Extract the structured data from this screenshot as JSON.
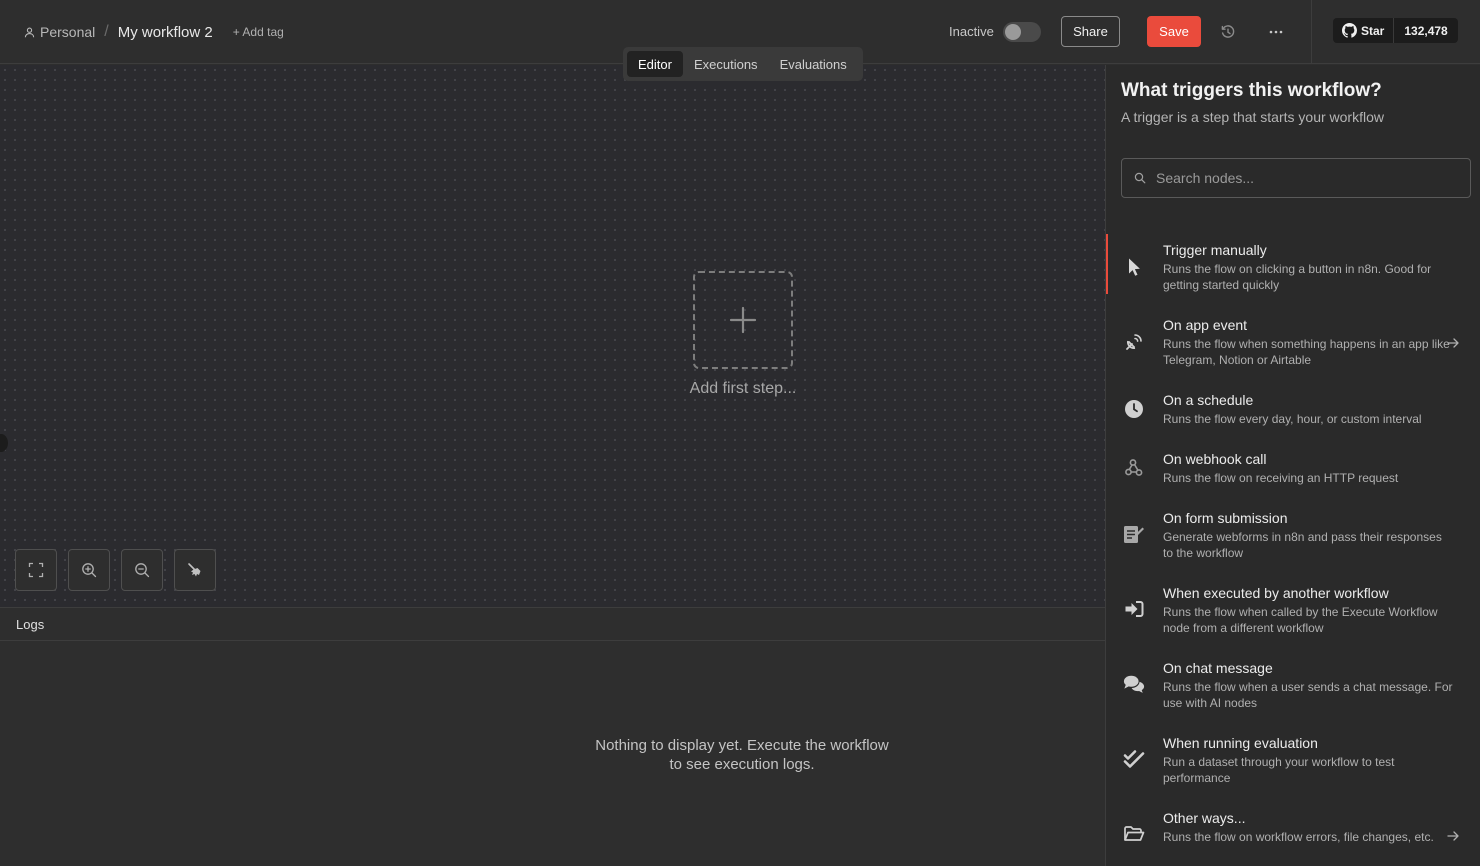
{
  "header": {
    "breadcrumb_project": "Personal",
    "breadcrumb_separator": "/",
    "workflow_name": "My workflow 2",
    "add_tag": "+ Add tag",
    "status_label": "Inactive",
    "active": false,
    "share_label": "Share",
    "save_label": "Save",
    "github_star_label": "Star",
    "github_star_count": "132,478"
  },
  "tabs": [
    {
      "label": "Editor",
      "active": true
    },
    {
      "label": "Executions",
      "active": false
    },
    {
      "label": "Evaluations",
      "active": false
    }
  ],
  "canvas": {
    "add_first_step": "Add first step..."
  },
  "logs": {
    "title": "Logs",
    "empty_message": "Nothing to display yet. Execute the workflow to see execution logs."
  },
  "panel": {
    "title": "What triggers this workflow?",
    "subtitle": "A trigger is a step that starts your workflow",
    "search_placeholder": "Search nodes...",
    "items": [
      {
        "title": "Trigger manually",
        "description": "Runs the flow on clicking a button in n8n. Good for getting started quickly",
        "icon": "cursor-icon",
        "has_arrow": false,
        "active": true
      },
      {
        "title": "On app event",
        "description": "Runs the flow when something happens in an app like Telegram, Notion or Airtable",
        "icon": "satellite-dish-icon",
        "has_arrow": true,
        "active": false
      },
      {
        "title": "On a schedule",
        "description": "Runs the flow every day, hour, or custom interval",
        "icon": "clock-icon",
        "has_arrow": false,
        "active": false
      },
      {
        "title": "On webhook call",
        "description": "Runs the flow on receiving an HTTP request",
        "icon": "webhook-icon",
        "has_arrow": false,
        "active": false
      },
      {
        "title": "On form submission",
        "description": "Generate webforms in n8n and pass their responses to the workflow",
        "icon": "form-icon",
        "has_arrow": false,
        "active": false
      },
      {
        "title": "When executed by another workflow",
        "description": "Runs the flow when called by the Execute Workflow node from a different workflow",
        "icon": "sign-in-icon",
        "has_arrow": false,
        "active": false
      },
      {
        "title": "On chat message",
        "description": "Runs the flow when a user sends a chat message. For use with AI nodes",
        "icon": "chat-icon",
        "has_arrow": false,
        "active": false
      },
      {
        "title": "When running evaluation",
        "description": "Run a dataset through your workflow to test performance",
        "icon": "check-double-icon",
        "has_arrow": false,
        "active": false
      },
      {
        "title": "Other ways...",
        "description": "Runs the flow on workflow errors, file changes, etc.",
        "icon": "folder-open-icon",
        "has_arrow": true,
        "active": false
      }
    ]
  },
  "colors": {
    "accent": "#ea4b3c",
    "background": "#2e2e2e",
    "canvas": "#2b2b2f",
    "panel": "#2a2a2a"
  }
}
